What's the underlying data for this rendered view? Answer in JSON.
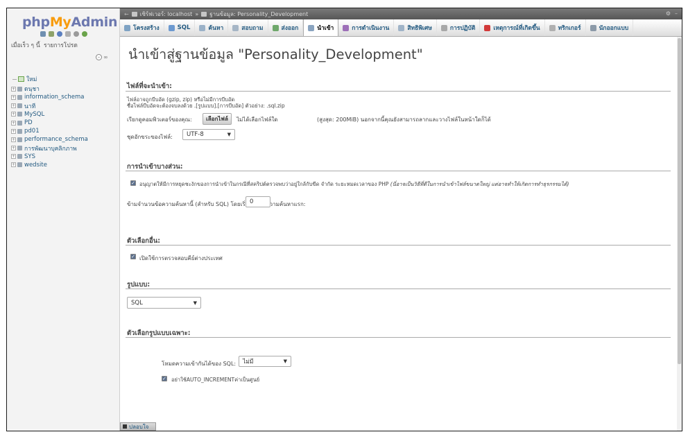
{
  "sidebar": {
    "logo": {
      "php": "php",
      "my": "My",
      "admin": "Admin"
    },
    "recent_label": "เมื่อเร็ว ๆ นี้",
    "favorites_label": "รายการโปรด",
    "collapse_icons": [
      "collapse-all-icon",
      "link-icon"
    ],
    "new_label": "ใหม่",
    "databases": [
      "ดนุชา",
      "information_schema",
      "นาที",
      "MySQL",
      "PD",
      "pd01",
      "performance_schema",
      "การพัฒนาบุคลิกภาพ",
      "SYS",
      "wedsite"
    ]
  },
  "topbar": {
    "server_label": "เซิร์ฟเวอร์: localhost",
    "separator": "»",
    "db_label": "ฐานข้อมูล: Personality_Development"
  },
  "menu": {
    "tabs": [
      {
        "label": "โครงสร้าง",
        "icon": "structure-icon",
        "color": "#7fa3c4"
      },
      {
        "label": "SQL",
        "icon": "sql-icon",
        "color": "#6d9ad0"
      },
      {
        "label": "ค้นหา",
        "icon": "search-icon",
        "color": "#9bb2c8"
      },
      {
        "label": "สอบถาม",
        "icon": "query-icon",
        "color": "#a6b6c6"
      },
      {
        "label": "ส่งออก",
        "icon": "export-icon",
        "color": "#6fa86b"
      },
      {
        "label": "นำเข้า",
        "icon": "import-icon",
        "color": "#8aa4c0",
        "active": true
      },
      {
        "label": "การดำเนินงาน",
        "icon": "operations-icon",
        "color": "#9d6fb8"
      },
      {
        "label": "สิทธิพิเศษ",
        "icon": "privileges-icon",
        "color": "#a0b4c8"
      },
      {
        "label": "การปฏิบัติ",
        "icon": "routines-icon",
        "color": "#a8a8a8"
      },
      {
        "label": "เหตุการณ์ที่เกิดขึ้น",
        "icon": "events-icon",
        "color": "#d23a3a"
      },
      {
        "label": "ทริกเกอร์",
        "icon": "triggers-icon",
        "color": "#b0b0b0"
      },
      {
        "label": "นักออกแบบ",
        "icon": "designer-icon",
        "color": "#8c9aa8"
      }
    ]
  },
  "page": {
    "title": "นำเข้าสู่ฐานข้อมูล \"Personality_Development\""
  },
  "file_section": {
    "heading": "ไฟล์ที่จะนำเข้า:",
    "info_line1": "ไฟล์อาจถูกบีบอัด (gzip, zip) หรือไม่มีการบีบอัด",
    "info_line2": "ชื่อไฟล์บีบอัดจะต้องจบลงด้วย .[รูปแบบ].[การบีบอัด] ตัวอย่าง: .sql.zip",
    "browse_label": "เรียกดูคอมพิวเตอร์ของคุณ:",
    "choose_button": "เลือกไฟล์",
    "no_file": "ไม่ได้เลือกไฟล์ใด",
    "max_note": "(สูงสุด: 200MiB) นอกจากนี้คุณยังสามารถลากและวางไฟล์ในหน้าใดก็ได้",
    "charset_label": "ชุดอักขระของไฟล์:",
    "charset_value": "UTF-8"
  },
  "partial_section": {
    "heading": "การนำเข้าบางส่วน:",
    "allow_interrupt": "อนุญาตให้มีการหยุดชะงักของการนำเข้าในกรณีที่สคริปต์ตรวจพบว่าอยู่ใกล้กับขีด จำกัด ระยะหมดเวลาของ PHP",
    "allow_note": "(นี่อาจเป็นวิธีที่ดีในการนำเข้าไฟล์ขนาดใหญ่ แต่อาจทำให้เกิดการทำธุรกรรมได้)",
    "skip_label": "ข้ามจำนวนข้อความค้นหานี้ (สำหรับ SQL) โดยเริ่มจากข้อความค้นหาแรก:",
    "skip_value": "0"
  },
  "other_section": {
    "heading": "ตัวเลือกอื่น:",
    "fk_checks": "เปิดใช้การตรวจสอบคีย์ต่างประเทศ"
  },
  "format_section": {
    "heading": "รูปแบบ:",
    "format_value": "SQL"
  },
  "specific_section": {
    "heading": "ตัวเลือกรูปแบบเฉพาะ:",
    "compat_label": "โหมดความเข้ากันได้ของ SQL:",
    "compat_value": "ไม่มี",
    "auto_inc": "อย่าใช้AUTO_INCREMENTค่าเป็นศูนย์"
  },
  "console": {
    "label": "ปลอบใจ"
  }
}
